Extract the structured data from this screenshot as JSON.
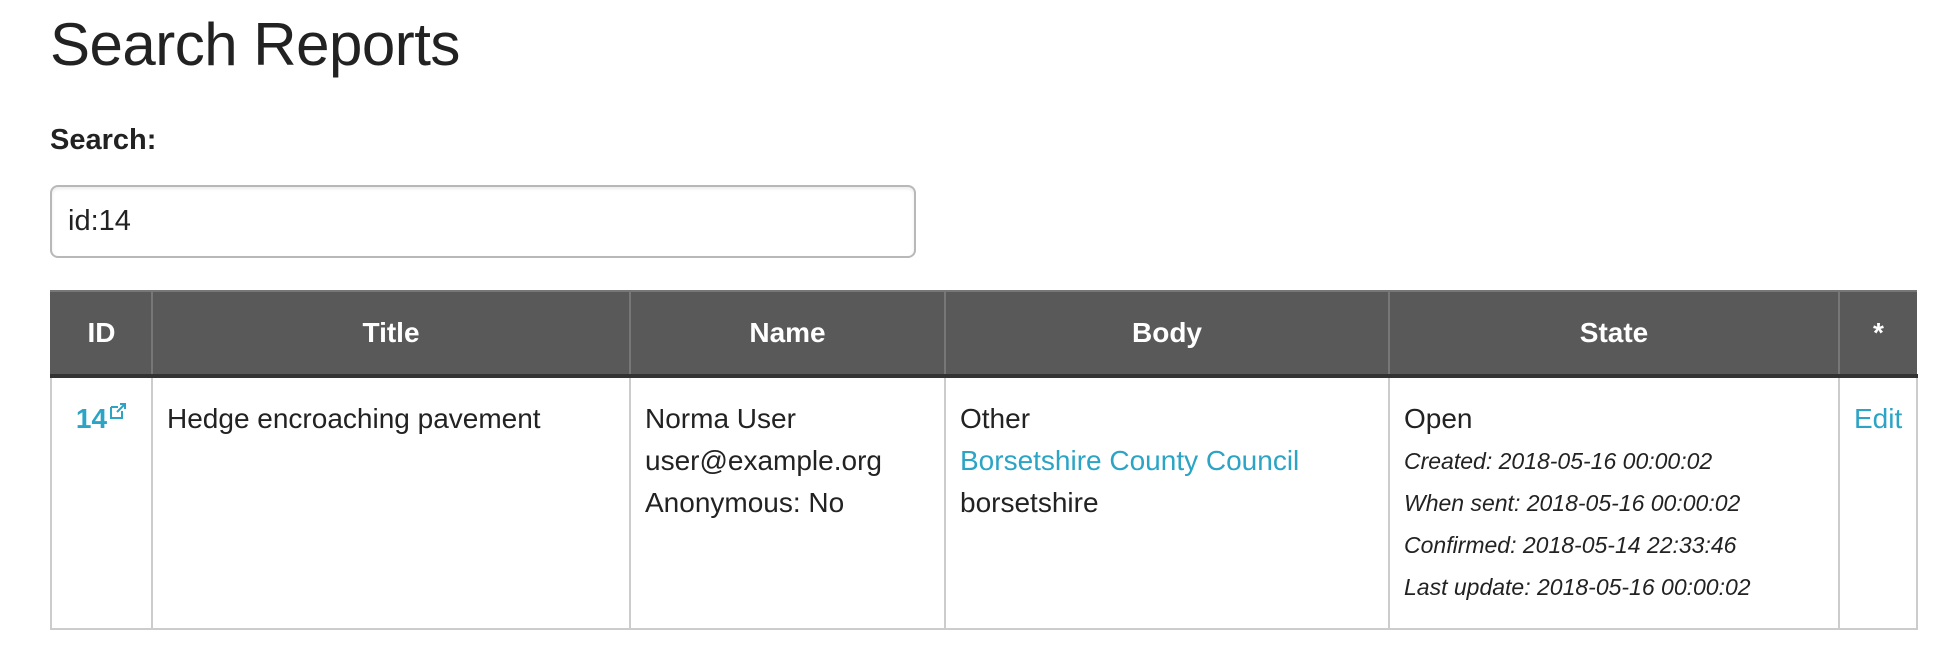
{
  "page": {
    "title": "Search Reports"
  },
  "search": {
    "label": "Search:",
    "value": "id:14"
  },
  "table": {
    "headers": {
      "id": "ID",
      "title": "Title",
      "name": "Name",
      "body": "Body",
      "state": "State",
      "actions": "*"
    },
    "rows": [
      {
        "id": "14",
        "title": "Hedge encroaching pavement",
        "name": {
          "user": "Norma User",
          "email": "user@example.org",
          "anonymous": "Anonymous: No"
        },
        "body": {
          "category": "Other",
          "council": "Borsetshire County Council",
          "area": "borsetshire"
        },
        "state": {
          "status": "Open",
          "created": "Created: 2018-05-16 00:00:02",
          "when_sent": "When sent: 2018-05-16 00:00:02",
          "confirmed": "Confirmed: 2018-05-14 22:33:46",
          "last_update": "Last update: 2018-05-16 00:00:02"
        },
        "action_label": "Edit"
      }
    ]
  },
  "colors": {
    "link": "#2ba4c5",
    "header_bg": "#595959",
    "text": "#222222"
  },
  "icons": {
    "external_link": "external-link-icon"
  }
}
